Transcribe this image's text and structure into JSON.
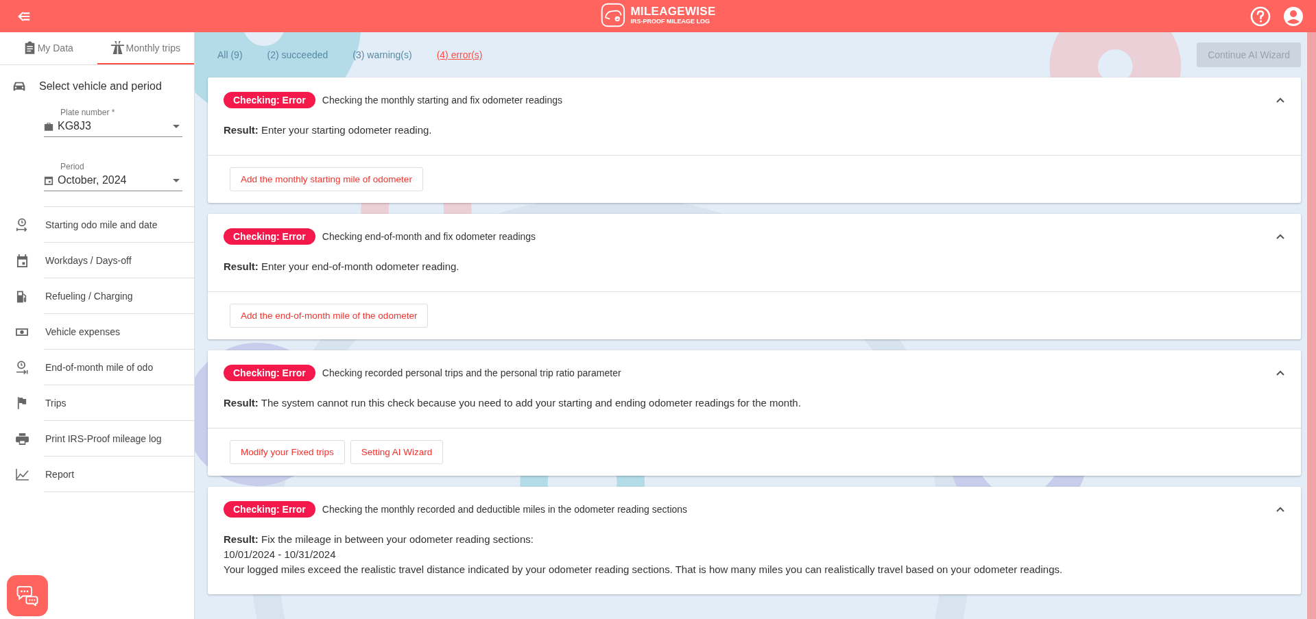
{
  "header": {
    "logo_title": "MILEAGEWISE",
    "logo_subtitle": "IRS-PROOF MILEAGE LOG"
  },
  "sidebar": {
    "tabs": [
      {
        "label": "My Data",
        "selected": false
      },
      {
        "label": "Monthly trips",
        "selected": true
      }
    ],
    "section_title": "Select vehicle and period",
    "fields": [
      {
        "label": "Plate number *",
        "value": "KG8J3"
      },
      {
        "label": "Period",
        "value": "October, 2024"
      }
    ],
    "items": [
      {
        "label": "Starting odo mile and date"
      },
      {
        "label": "Workdays / Days-off"
      },
      {
        "label": "Refueling / Charging"
      },
      {
        "label": "Vehicle expenses"
      },
      {
        "label": "End-of-month mile of odo"
      },
      {
        "label": "Trips"
      },
      {
        "label": "Print IRS-Proof mileage log"
      },
      {
        "label": "Report"
      }
    ]
  },
  "filters": [
    {
      "label": "All (9)",
      "selected": false
    },
    {
      "label": "(2) succeeded",
      "selected": false
    },
    {
      "label": "(3) warning(s)",
      "selected": false
    },
    {
      "label": "(4) error(s)",
      "selected": true
    }
  ],
  "continue_button": {
    "label": "Continue AI Wizard",
    "disabled": true
  },
  "checks": [
    {
      "status": "Checking: Error",
      "title": "Checking the monthly starting and fix odometer readings",
      "expanded": true,
      "result": [
        "**Result:** Enter your starting odometer reading."
      ],
      "actions": [
        "Add the monthly starting mile of odometer"
      ]
    },
    {
      "status": "Checking: Error",
      "title": "Checking end-of-month and fix odometer readings",
      "expanded": true,
      "result": [
        "**Result:** Enter your end-of-month odometer reading."
      ],
      "actions": [
        "Add the end-of-month mile of the odometer"
      ]
    },
    {
      "status": "Checking: Error",
      "title": "Checking recorded personal trips and the personal trip ratio parameter",
      "expanded": true,
      "result": [
        "**Result:** The system cannot run this check because you need to add your starting and ending odometer readings for the month."
      ],
      "actions": [
        "Modify your Fixed trips",
        "Setting AI Wizard"
      ]
    },
    {
      "status": "Checking: Error",
      "title": "Checking the monthly recorded and deductible miles in the odometer reading sections",
      "expanded": true,
      "result": [
        "**Result:** Fix the mileage in between your odometer reading sections:",
        "10/01/2024 - 10/31/2024",
        "Your logged miles exceed the realistic travel distance indicated by your odometer reading sections. That is how many miles you can realistically travel based on your odometer readings."
      ]
    }
  ]
}
